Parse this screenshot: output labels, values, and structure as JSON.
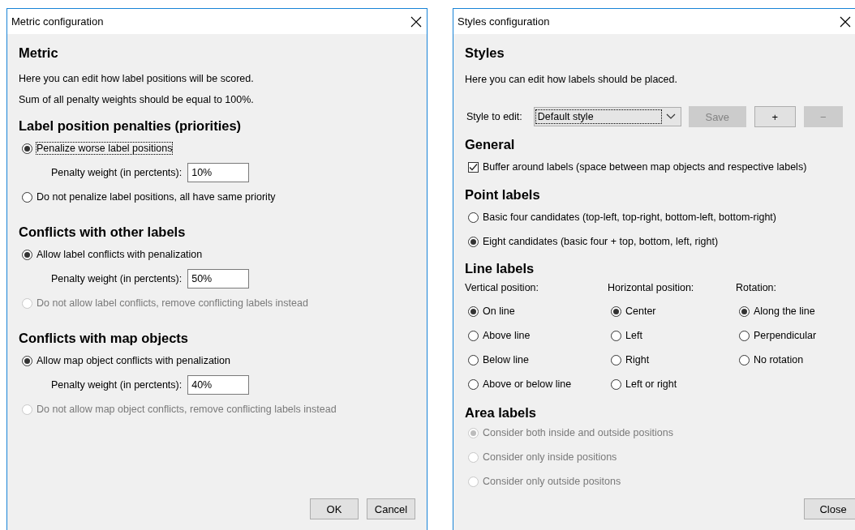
{
  "metric_dialog": {
    "title": "Metric configuration",
    "heading": "Metric",
    "intro": [
      "Here you can edit how label positions will be scored.",
      "Sum of all penalty weights should be equal to 100%."
    ],
    "sections": [
      {
        "title": "Label position penalties (priorities)",
        "options": [
          {
            "label": "Penalize worse label positions",
            "selected": true,
            "disabled": false,
            "focused": true,
            "weight": {
              "label": "Penalty weight (in perctents):",
              "value": "10%"
            }
          },
          {
            "label": "Do not penalize label positions, all have same priority",
            "selected": false,
            "disabled": false,
            "focused": false
          }
        ]
      },
      {
        "title": "Conflicts with other labels",
        "options": [
          {
            "label": "Allow label conflicts with penalization",
            "selected": true,
            "disabled": false,
            "focused": false,
            "weight": {
              "label": "Penalty weight (in perctents):",
              "value": "50%"
            }
          },
          {
            "label": "Do not allow label conflicts, remove conflicting labels instead",
            "selected": false,
            "disabled": true,
            "focused": false
          }
        ]
      },
      {
        "title": "Conflicts with map objects",
        "options": [
          {
            "label": "Allow map object conflicts with penalization",
            "selected": true,
            "disabled": false,
            "focused": false,
            "weight": {
              "label": "Penalty weight (in perctents):",
              "value": "40%"
            }
          },
          {
            "label": "Do not allow map object conflicts, remove conflicting labels instead",
            "selected": false,
            "disabled": true,
            "focused": false
          }
        ]
      }
    ],
    "buttons": [
      {
        "label": "OK",
        "disabled": false
      },
      {
        "label": "Cancel",
        "disabled": false
      }
    ]
  },
  "styles_dialog": {
    "title": "Styles configuration",
    "heading": "Styles",
    "intro": "Here you can edit how labels should be placed.",
    "style_selector": {
      "label": "Style to edit:",
      "value": "Default style",
      "focused": true,
      "buttons": [
        {
          "label": "Save",
          "disabled": true
        },
        {
          "label": "+",
          "disabled": false
        },
        {
          "label": "−",
          "disabled": true
        }
      ]
    },
    "general": {
      "title": "General",
      "checkbox": {
        "label": "Buffer around labels (space between map objects and respective labels)",
        "checked": true
      }
    },
    "point_labels": {
      "title": "Point labels",
      "options": [
        {
          "label": "Basic four candidates (top-left, top-right, bottom-left, bottom-right)",
          "selected": false,
          "disabled": false
        },
        {
          "label": "Eight candidates (basic four + top, bottom, left, right)",
          "selected": true,
          "disabled": false
        }
      ]
    },
    "line_labels": {
      "title": "Line labels",
      "columns": [
        {
          "heading": "Vertical position:",
          "options": [
            {
              "label": "On line",
              "selected": true,
              "disabled": false
            },
            {
              "label": "Above line",
              "selected": false,
              "disabled": false
            },
            {
              "label": "Below line",
              "selected": false,
              "disabled": false
            },
            {
              "label": "Above or below line",
              "selected": false,
              "disabled": false
            }
          ]
        },
        {
          "heading": "Horizontal position:",
          "options": [
            {
              "label": "Center",
              "selected": true,
              "disabled": false
            },
            {
              "label": "Left",
              "selected": false,
              "disabled": false
            },
            {
              "label": "Right",
              "selected": false,
              "disabled": false
            },
            {
              "label": "Left or right",
              "selected": false,
              "disabled": false
            }
          ]
        },
        {
          "heading": "Rotation:",
          "options": [
            {
              "label": "Along the line",
              "selected": true,
              "disabled": false
            },
            {
              "label": "Perpendicular",
              "selected": false,
              "disabled": false
            },
            {
              "label": "No rotation",
              "selected": false,
              "disabled": false
            }
          ]
        }
      ]
    },
    "area_labels": {
      "title": "Area labels",
      "options": [
        {
          "label": "Consider both inside and outside positions",
          "selected": true,
          "disabled": true
        },
        {
          "label": "Consider only inside positions",
          "selected": false,
          "disabled": true
        },
        {
          "label": "Consider only outside positons",
          "selected": false,
          "disabled": true
        }
      ]
    },
    "buttons": [
      {
        "label": "Close",
        "disabled": false
      }
    ]
  }
}
